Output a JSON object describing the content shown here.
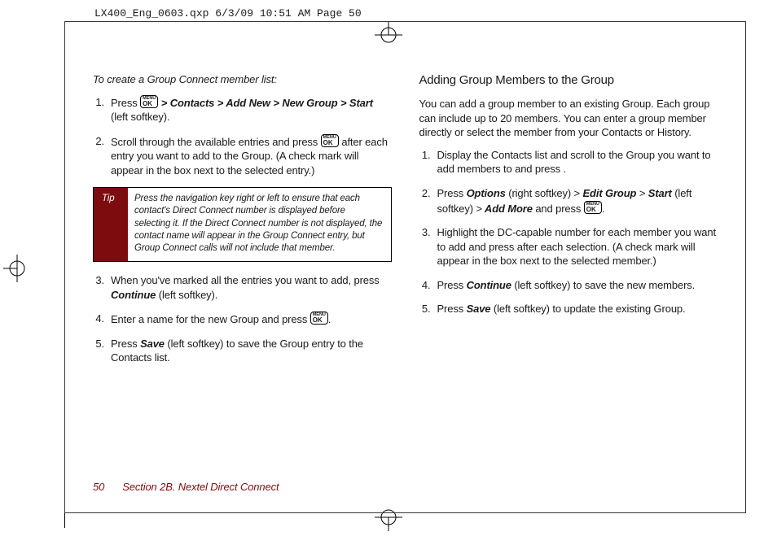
{
  "header_line": "LX400_Eng_0603.qxp  6/3/09  10:51 AM  Page 50",
  "ok_top": "MENU",
  "ok_bottom": "OK",
  "left": {
    "intro": "To create a Group Connect member list:",
    "steps_a": {
      "1_pre": "Press ",
      "1_menu": " > Contacts > Add New > New Group > Start",
      "1_post": " (left softkey).",
      "2_pre": "Scroll through the available entries and press ",
      "2_post": " after each entry you want to add to the Group. (A check mark will appear in the box next to the selected entry.)"
    },
    "tip_label": "Tip",
    "tip_text": "Press the navigation key right or left to ensure that each contact's Direct Connect number is displayed before selecting it. If the Direct Connect number is not displayed, the contact name will appear in the Group Connect entry, but Group Connect calls will not include that member.",
    "steps_b": {
      "3_pre": "When you've marked all the entries you want to add, press ",
      "3_em": "Continue",
      "3_post": " (left softkey).",
      "4_pre": "Enter a name for the new Group and press ",
      "4_post": ".",
      "5_pre": "Press ",
      "5_em": "Save",
      "5_post": " (left softkey) to save the Group entry to the Contacts list."
    }
  },
  "right": {
    "heading": "Adding Group Members to the Group",
    "para": "You can add a group member to an existing Group. Each group can include up to 20 members. You can enter a group member directly or select the member from your Contacts or History.",
    "steps": {
      "1": "Display the Contacts list and scroll to the Group you want to add members to and press .",
      "2_pre": "Press ",
      "2_em1": "Options",
      "2_mid1": " (right softkey) ",
      "2_sep1": ">",
      "2_em2": " Edit Group ",
      "2_sep2": ">",
      "2_em3": " Start",
      "2_mid2": " (left softkey) ",
      "2_sep3": ">",
      "2_em4": " Add More",
      "2_mid3": " and press ",
      "2_post": ".",
      "3": "Highlight the DC-capable number for each member you want to add and press  after each selection. (A check mark will appear in the box next to the selected member.)",
      "4_pre": "Press ",
      "4_em": "Continue",
      "4_post": " (left softkey) to save the new members.",
      "5_pre": "Press ",
      "5_em": "Save",
      "5_post": " (left softkey) to update the existing Group."
    }
  },
  "footer_page": "50",
  "footer_section": "Section 2B. Nextel Direct Connect"
}
